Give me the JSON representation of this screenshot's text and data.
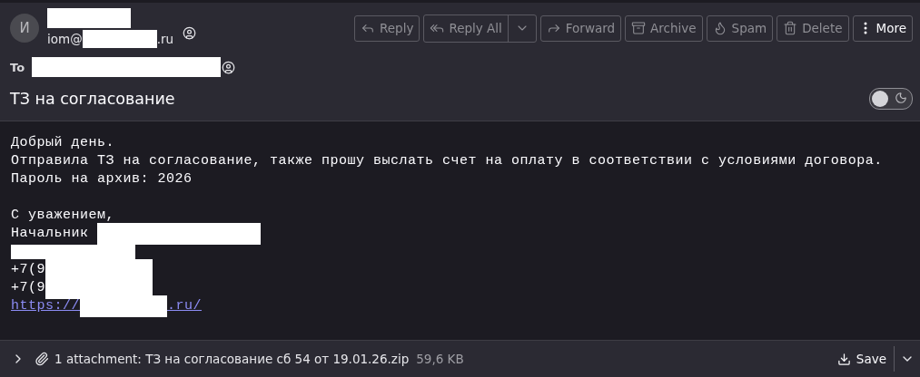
{
  "sender": {
    "avatar_letter": "И",
    "name": [
      {
        "kind": "redacted"
      }
    ],
    "email": [
      {
        "kind": "text",
        "text": "iom@"
      },
      {
        "kind": "redacted"
      },
      {
        "kind": "text",
        "text": ".ru"
      }
    ]
  },
  "toolbar": [
    {
      "kind": "reply",
      "label": "Reply",
      "disabled": true
    },
    {
      "kind": "reply_all",
      "label": "Reply All",
      "disabled": true
    },
    {
      "kind": "forward",
      "label": "Forward",
      "disabled": true
    },
    {
      "kind": "archive",
      "label": "Archive",
      "disabled": true
    },
    {
      "kind": "spam",
      "label": "Spam",
      "disabled": true
    },
    {
      "kind": "delete",
      "label": "Delete",
      "disabled": true
    },
    {
      "kind": "more",
      "label": "More",
      "disabled": false
    }
  ],
  "to": {
    "label": "To",
    "value": [
      {
        "kind": "redacted"
      }
    ]
  },
  "subject": "ТЗ на согласование",
  "dark_mode_toggle": {
    "on": false
  },
  "body": [
    {
      "kind": "line",
      "parts": [
        {
          "kind": "text",
          "text": "Добрый день."
        }
      ]
    },
    {
      "kind": "line",
      "parts": [
        {
          "kind": "text",
          "text": "Отправила ТЗ на согласование, также прошу выслать счет на оплату в соответствии с условиями договора."
        }
      ]
    },
    {
      "kind": "line",
      "parts": [
        {
          "kind": "text",
          "text": "Пароль на архив: 2026"
        }
      ]
    },
    {
      "kind": "blank"
    },
    {
      "kind": "line",
      "parts": [
        {
          "kind": "text",
          "text": "С уважением,"
        }
      ]
    },
    {
      "kind": "line",
      "parts": [
        {
          "kind": "text",
          "text": "Начальник "
        },
        {
          "kind": "redacted"
        }
      ]
    },
    {
      "kind": "line",
      "parts": [
        {
          "kind": "redacted"
        }
      ]
    },
    {
      "kind": "line",
      "parts": [
        {
          "kind": "text",
          "text": "+7(9"
        },
        {
          "kind": "redacted"
        }
      ]
    },
    {
      "kind": "line",
      "parts": [
        {
          "kind": "text",
          "text": "+7(9"
        },
        {
          "kind": "redacted"
        }
      ]
    },
    {
      "kind": "line",
      "parts": [
        {
          "kind": "link",
          "text": "https://"
        },
        {
          "kind": "redacted"
        },
        {
          "kind": "link",
          "text": ".ru/"
        }
      ]
    }
  ],
  "attachment": {
    "expanded": false,
    "summary": "1 attachment: ТЗ на согласование сб 54 от 19.01.26.zip",
    "size": "59,6 KB",
    "save_label": "Save"
  }
}
